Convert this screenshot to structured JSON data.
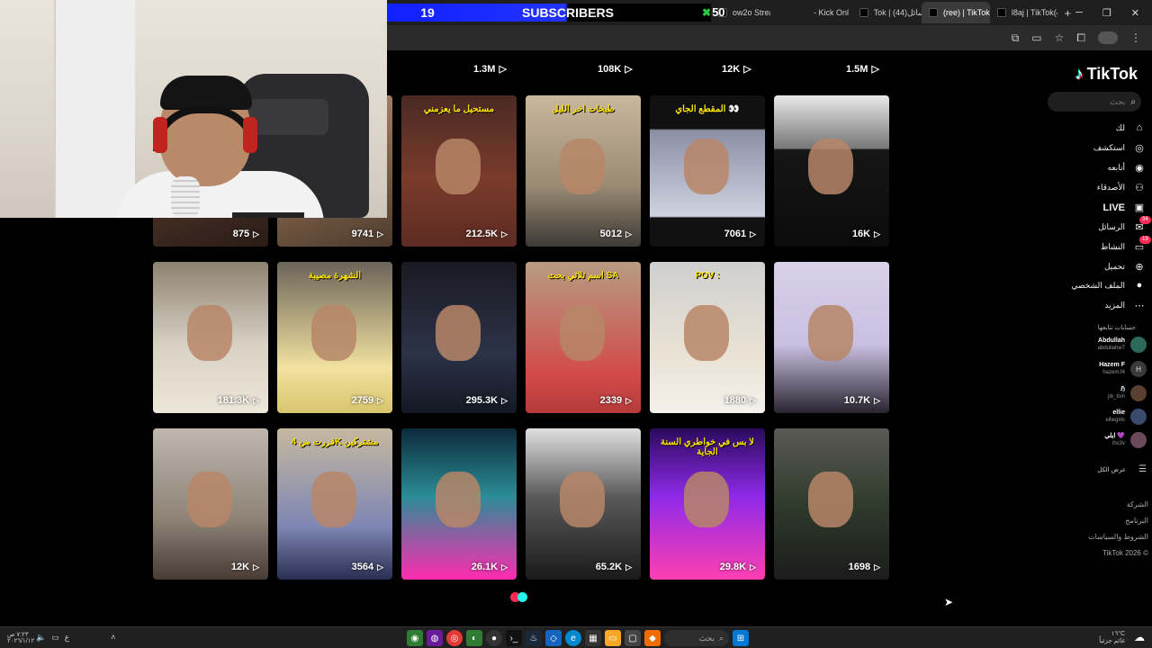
{
  "overlay": {
    "sub_count": "19",
    "sub_label": "SUBSCRIBERS",
    "sub_goal": "50"
  },
  "browser": {
    "tabs": [
      {
        "label": "ow2o Stream - Y"
      },
      {
        "label": "- Kick Onl"
      },
      {
        "label": "Tok | (الرسائل(44"
      },
      {
        "label": "(ree) | TikTok(30"
      },
      {
        "label": "l8aj | TikTok(44)"
      }
    ],
    "new_tab": "+"
  },
  "tiktok": {
    "logo": "TikTok",
    "search_placeholder": "بحث",
    "nav": [
      {
        "label": "لك",
        "icon": "home-icon"
      },
      {
        "label": "استكشف",
        "icon": "compass-icon"
      },
      {
        "label": "أتابعه",
        "icon": "following-icon"
      },
      {
        "label": "الأصدقاء",
        "icon": "friends-icon"
      },
      {
        "label": "LIVE",
        "icon": "live-icon"
      },
      {
        "label": "الرسائل",
        "icon": "messages-icon",
        "badge": "34"
      },
      {
        "label": "النشاط",
        "icon": "activity-icon",
        "badge": "19"
      },
      {
        "label": "تحميل",
        "icon": "upload-icon"
      },
      {
        "label": "الملف الشخصي",
        "icon": "profile-icon"
      },
      {
        "label": "المزيد",
        "icon": "more-icon"
      }
    ],
    "following_title": "حسابات تتابعها",
    "following": [
      {
        "name": "Abdullah",
        "handle": "abdullahw7",
        "initial": ""
      },
      {
        "name": "Hazem F",
        "handle": "hazem.f4",
        "initial": "H"
      },
      {
        "name": "ℌ",
        "handle": "jib_toin",
        "initial": ""
      },
      {
        "name": "ellie",
        "handle": "elliegirls",
        "initial": ""
      },
      {
        "name": "ايلي 💜",
        "handle": "ihc3v",
        "initial": ""
      }
    ],
    "show_all": "عرض الكل",
    "footer": [
      "الشركة",
      "البرنامج",
      "الشروط والسياسات",
      "TikTok 2026 ©"
    ]
  },
  "videos_top": [
    "1.3M",
    "108K",
    "12K",
    "1.5M"
  ],
  "videos": [
    {
      "views": "875",
      "caption": ""
    },
    {
      "views": "9741",
      "caption": ""
    },
    {
      "views": "212.5K",
      "caption": "مستحيل ما يعزمني"
    },
    {
      "views": "5012",
      "caption": "طبخات اخر الليل"
    },
    {
      "views": "7061",
      "caption": "المقطع الجاي 👀"
    },
    {
      "views": "16K",
      "caption": ""
    },
    {
      "views": "181.3K",
      "caption": ""
    },
    {
      "views": "2759",
      "caption": "الشهرة مصيبة"
    },
    {
      "views": "295.3K",
      "caption": ""
    },
    {
      "views": "2339",
      "caption": "اسم ثلاثي بحث SA"
    },
    {
      "views": "1880",
      "caption": "POV :"
    },
    {
      "views": "10.7K",
      "caption": ""
    },
    {
      "views": "12K",
      "caption": ""
    },
    {
      "views": "3564",
      "caption": "قررت من 4K مشتركين"
    },
    {
      "views": "26.1K",
      "caption": ""
    },
    {
      "views": "65.2K",
      "caption": ""
    },
    {
      "views": "29.8K",
      "caption": "لا بس في خواطري السنة الجاية"
    },
    {
      "views": "1698",
      "caption": ""
    }
  ],
  "taskbar": {
    "search_label": "بحث",
    "clock_time": "٧:٢٣ ص",
    "clock_date": "٢٠٢٦/١/١٢",
    "weather": "١٦°C",
    "weather_desc": "غائم جزئياً"
  }
}
